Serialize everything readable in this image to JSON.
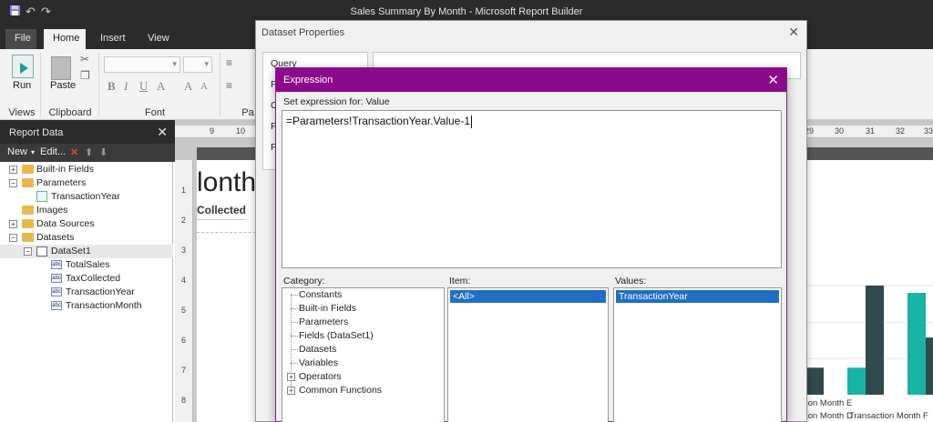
{
  "window": {
    "title": "Sales Summary By Month - Microsoft Report Builder"
  },
  "quick_access": {
    "save_icon": "save-icon",
    "undo_icon": "undo-icon",
    "redo_icon": "redo-icon"
  },
  "ribbon_tabs": [
    "File",
    "Home",
    "Insert",
    "View"
  ],
  "ribbon": {
    "run_label": "Run",
    "paste_label": "Paste",
    "groups": [
      "Views",
      "Clipboard",
      "Font",
      "Pa"
    ]
  },
  "report_data": {
    "title": "Report Data",
    "toolbar": {
      "new": "New",
      "edit": "Edit..."
    },
    "tree": {
      "builtin": "Built-in Fields",
      "parameters": "Parameters",
      "param_transaction_year": "TransactionYear",
      "images": "Images",
      "data_sources": "Data Sources",
      "datasets": "Datasets",
      "dataset1": "DataSet1",
      "fields": [
        "TotalSales",
        "TaxCollected",
        "TransactionYear",
        "TransactionMonth"
      ]
    }
  },
  "ruler": {
    "top_left": [
      "9",
      "10"
    ],
    "top_right": [
      "29",
      "30",
      "31",
      "32",
      "33"
    ],
    "left": [
      "1",
      "2",
      "3",
      "4",
      "5",
      "6",
      "7",
      "8"
    ]
  },
  "report_body": {
    "title_fragment": "lonth",
    "column_fragment": "Collected"
  },
  "dataset_properties": {
    "title": "Dataset Properties",
    "nav": [
      "Query",
      "F",
      "O",
      "F",
      "P"
    ]
  },
  "expression_dialog": {
    "title": "Expression",
    "set_for": "Set expression for: Value",
    "expression": "=Parameters!TransactionYear.Value-1",
    "category_label": "Category:",
    "item_label": "Item:",
    "values_label": "Values:",
    "categories": [
      "Constants",
      "Built-in Fields",
      "Parameters",
      "Fields (DataSet1)",
      "Datasets",
      "Variables",
      "Operators",
      "Common Functions"
    ],
    "items": [
      "<All>"
    ],
    "values": [
      "TransactionYear"
    ]
  },
  "chart_data": {
    "type": "bar",
    "title": "",
    "categories": [
      "Transaction Month D",
      "Transaction Month E",
      "Transaction Month F"
    ],
    "series": [
      {
        "values": [
          26,
          26,
          98
        ]
      },
      {
        "values": [
          26,
          105,
          55
        ]
      }
    ],
    "colors": [
      "#19b3a3",
      "#2f4a4d"
    ]
  }
}
